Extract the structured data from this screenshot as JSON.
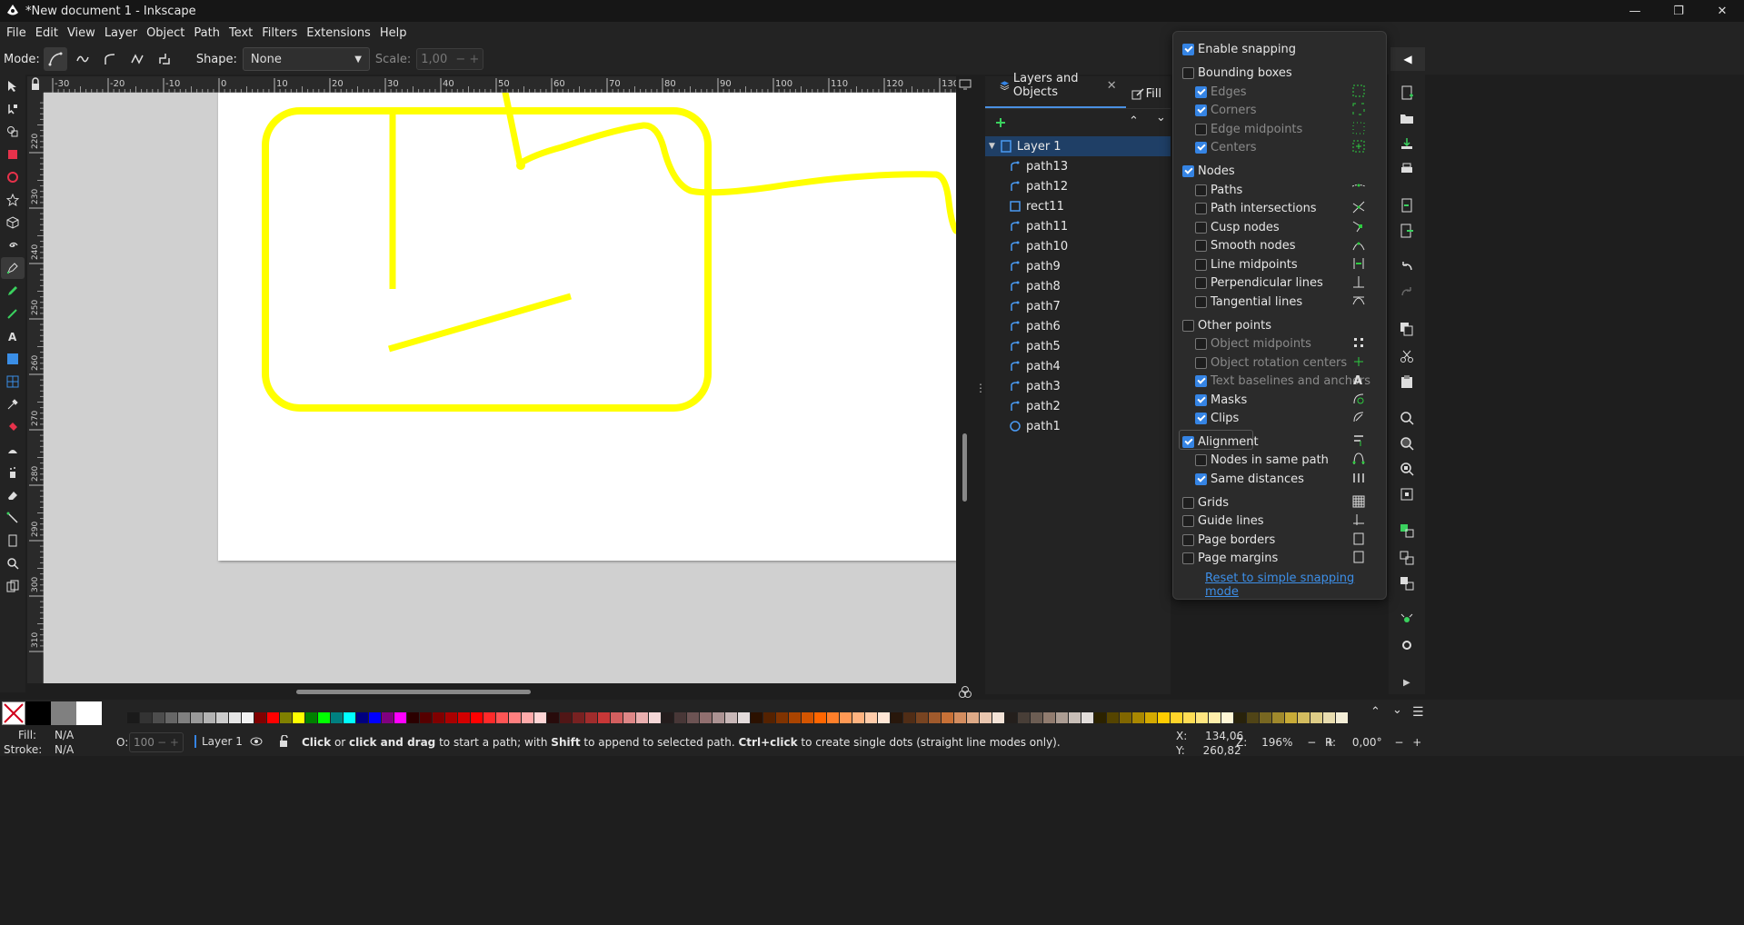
{
  "window": {
    "title": "*New document 1 - Inkscape"
  },
  "menu": [
    "File",
    "Edit",
    "View",
    "Layer",
    "Object",
    "Path",
    "Text",
    "Filters",
    "Extensions",
    "Help"
  ],
  "tool_controls": {
    "mode_label": "Mode:",
    "shape_label": "Shape:",
    "shape_value": "None",
    "scale_label": "Scale:",
    "scale_value": "1,00"
  },
  "ruler": {
    "top_labels": [
      "-30",
      "-20",
      "-10",
      "0",
      "10",
      "20",
      "30",
      "40",
      "50",
      "60",
      "70",
      "80",
      "90",
      "100",
      "110",
      "120",
      "130"
    ],
    "left_labels": [
      "220",
      "230",
      "240",
      "250",
      "260",
      "270",
      "280",
      "290",
      "300",
      "310"
    ]
  },
  "dock": {
    "tabs": [
      "Layers and Objects",
      "Fill"
    ],
    "layer": "Layer 1",
    "objects": [
      {
        "name": "path13",
        "kind": "path"
      },
      {
        "name": "path12",
        "kind": "path"
      },
      {
        "name": "rect11",
        "kind": "rect"
      },
      {
        "name": "path11",
        "kind": "path"
      },
      {
        "name": "path10",
        "kind": "path"
      },
      {
        "name": "path9",
        "kind": "path"
      },
      {
        "name": "path8",
        "kind": "path"
      },
      {
        "name": "path7",
        "kind": "path"
      },
      {
        "name": "path6",
        "kind": "path"
      },
      {
        "name": "path5",
        "kind": "path"
      },
      {
        "name": "path4",
        "kind": "path"
      },
      {
        "name": "path3",
        "kind": "path"
      },
      {
        "name": "path2",
        "kind": "path"
      },
      {
        "name": "path1",
        "kind": "ellipse"
      }
    ]
  },
  "snapping": {
    "enable": {
      "label": "Enable snapping",
      "checked": true
    },
    "bounding_boxes": {
      "label": "Bounding boxes",
      "checked": false
    },
    "edges": {
      "label": "Edges",
      "checked": true
    },
    "corners": {
      "label": "Corners",
      "checked": true
    },
    "edge_midpoints": {
      "label": "Edge midpoints",
      "checked": false
    },
    "centers": {
      "label": "Centers",
      "checked": true
    },
    "nodes": {
      "label": "Nodes",
      "checked": true
    },
    "paths": {
      "label": "Paths",
      "checked": false
    },
    "path_intersections": {
      "label": "Path intersections",
      "checked": false
    },
    "cusp_nodes": {
      "label": "Cusp nodes",
      "checked": false
    },
    "smooth_nodes": {
      "label": "Smooth nodes",
      "checked": false
    },
    "line_midpoints": {
      "label": "Line midpoints",
      "checked": false
    },
    "perpendicular_lines": {
      "label": "Perpendicular lines",
      "checked": false
    },
    "tangential_lines": {
      "label": "Tangential lines",
      "checked": false
    },
    "other_points": {
      "label": "Other points",
      "checked": false
    },
    "object_midpoints": {
      "label": "Object midpoints",
      "checked": false
    },
    "object_rotation_centers": {
      "label": "Object rotation centers",
      "checked": false
    },
    "text_baselines": {
      "label": "Text baselines and anchors",
      "checked": true
    },
    "masks": {
      "label": "Masks",
      "checked": true
    },
    "clips": {
      "label": "Clips",
      "checked": true
    },
    "alignment": {
      "label": "Alignment",
      "checked": true
    },
    "nodes_same_path": {
      "label": "Nodes in same path",
      "checked": false
    },
    "same_distances": {
      "label": "Same distances",
      "checked": true
    },
    "grids": {
      "label": "Grids",
      "checked": false
    },
    "guide_lines": {
      "label": "Guide lines",
      "checked": false
    },
    "page_borders": {
      "label": "Page borders",
      "checked": false
    },
    "page_margins": {
      "label": "Page margins",
      "checked": false
    },
    "reset_link": "Reset to simple snapping mode"
  },
  "status": {
    "fill_label": "Fill:",
    "stroke_label": "Stroke:",
    "fill_value": "N/A",
    "stroke_value": "N/A",
    "opacity_label": "O:",
    "opacity_value": "100",
    "layer": "Layer 1",
    "message_parts": [
      "Click",
      " or ",
      "click and drag",
      " to start a path; with ",
      "Shift",
      " to append to selected path. ",
      "Ctrl+click",
      " to create single dots (straight line modes only)."
    ],
    "x_label": "X:",
    "x_value": "134,06",
    "y_label": "Y:",
    "y_value": "260,82",
    "zoom_label": "Z:",
    "zoom_value": "196%",
    "rotation_label": "R:",
    "rotation_value": "0,00°"
  },
  "colors": {
    "stroke_yellow": "#ffff00",
    "accent_blue": "#3584e4",
    "snap_green": "#2ecc40"
  }
}
